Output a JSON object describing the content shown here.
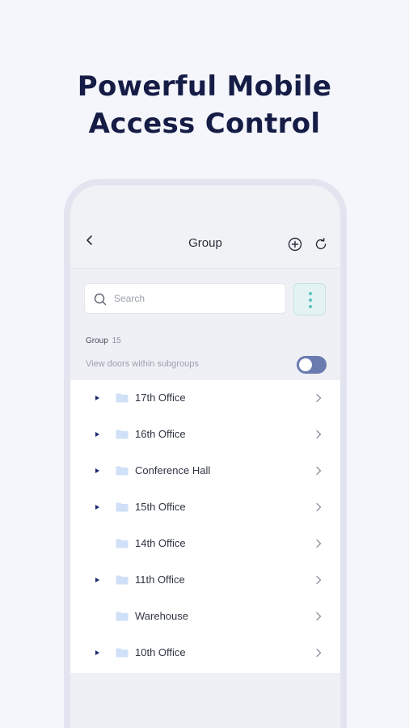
{
  "headline": {
    "line1": "Powerful Mobile",
    "line2": "Access Control"
  },
  "appbar": {
    "title": "Group"
  },
  "search": {
    "placeholder": "Search"
  },
  "group": {
    "label": "Group",
    "count": "15"
  },
  "subgroups": {
    "label": "View doors within subgroups",
    "enabled": true
  },
  "items": [
    {
      "label": "17th Office",
      "expandable": true
    },
    {
      "label": "16th Office",
      "expandable": true
    },
    {
      "label": "Conference Hall",
      "expandable": true
    },
    {
      "label": "15th Office",
      "expandable": true
    },
    {
      "label": "14th Office",
      "expandable": false
    },
    {
      "label": "11th Office",
      "expandable": true
    },
    {
      "label": "Warehouse",
      "expandable": false
    },
    {
      "label": "10th Office",
      "expandable": true
    }
  ],
  "colors": {
    "headline": "#151c45",
    "accent": "#5ac4c4",
    "toggle": "#6a7bb0",
    "folder": "#cfe0f7"
  },
  "icons": {
    "back": "chevron-left-icon",
    "add": "plus-circle-icon",
    "refresh": "refresh-icon",
    "search": "search-icon",
    "more": "more-vertical-icon",
    "folder": "folder-icon",
    "caret": "caret-right-icon",
    "row_chevron": "chevron-right-icon"
  }
}
